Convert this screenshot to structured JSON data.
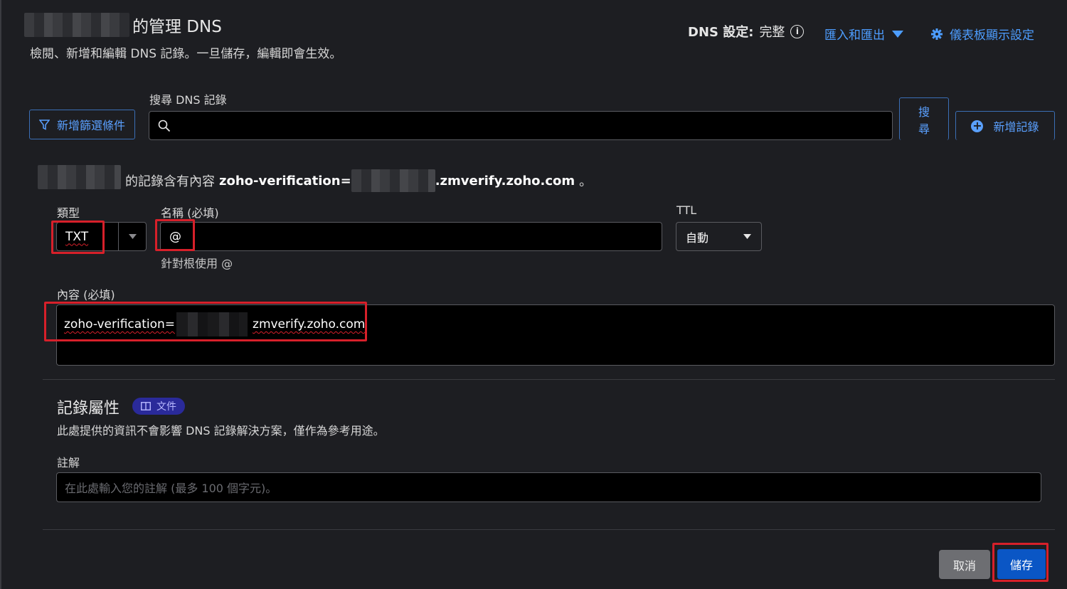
{
  "header": {
    "title_suffix": "的管理 DNS",
    "subtitle": "檢閱、新增和編輯 DNS 記錄。一旦儲存，編輯即會生效。",
    "dns_setting_label": "DNS 設定:",
    "dns_setting_value": "完整",
    "import_export_label": "匯入和匯出",
    "dashboard_settings_label": "儀表板顯示設定"
  },
  "search": {
    "label": "搜尋 DNS 記錄",
    "value": "",
    "filter_button": "新增篩選條件",
    "search_button_line1": "搜",
    "search_button_line2": "尋",
    "add_record_button": "新增記錄"
  },
  "record_info": {
    "prefix": "的記錄含有內容",
    "content_start": "zoho-verification=",
    "content_end": ".zmverify.zoho.com",
    "suffix": "。"
  },
  "form": {
    "type_label": "類型",
    "type_value": "TXT",
    "name_label": "名稱 (必填)",
    "name_value": "@",
    "name_hint": "針對根使用 @",
    "ttl_label": "TTL",
    "ttl_value": "自動",
    "content_label": "內容 (必填)",
    "content_start": "zoho-verification=",
    "content_end": "zmverify.zoho.com"
  },
  "attributes": {
    "title": "記錄屬性",
    "docs_badge": "文件",
    "description": "此處提供的資訊不會影響 DNS 記錄解決方案，僅作為參考用途。",
    "comment_label": "註解",
    "comment_placeholder": "在此處輸入您的註解 (最多 100 個字元)。"
  },
  "footer": {
    "cancel_label": "取消",
    "save_label": "儲存"
  },
  "colors": {
    "accent": "#4d9dff",
    "primary_button": "#0a56c5",
    "highlight_red": "#d7202a",
    "badge": "#2a2a9a"
  }
}
